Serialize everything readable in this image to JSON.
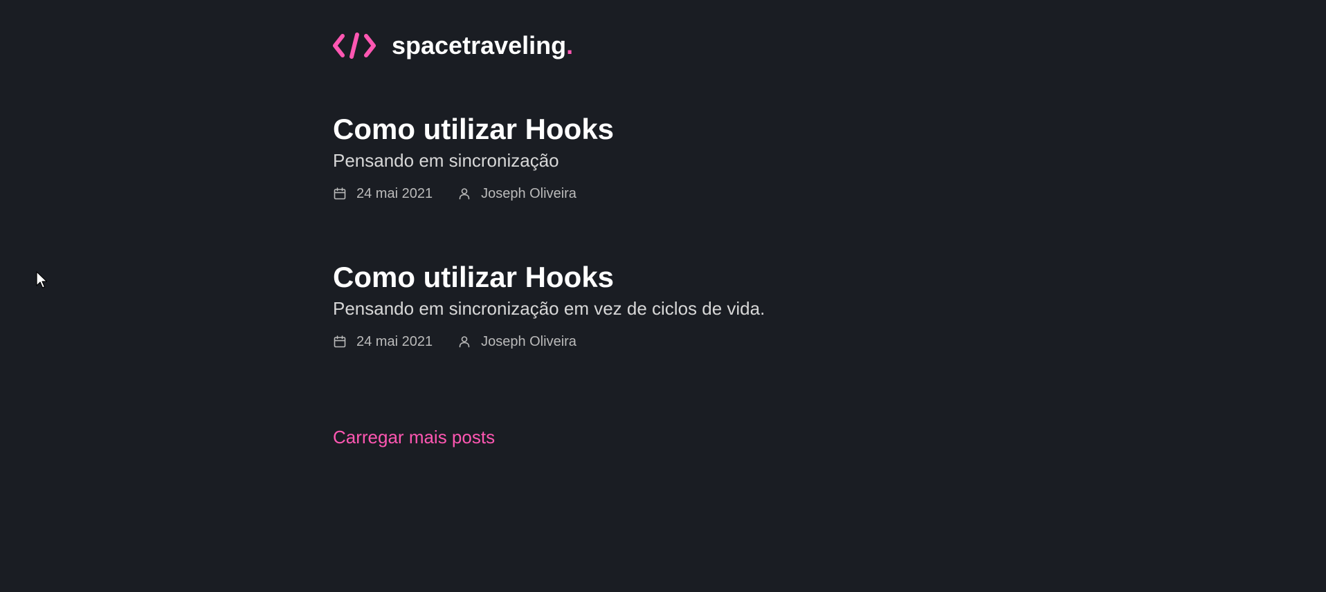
{
  "header": {
    "brand": "spacetraveling",
    "brand_dot": ".",
    "logo_icon": "code-brackets-icon"
  },
  "posts": [
    {
      "title": "Como utilizar Hooks",
      "subtitle": "Pensando em sincronização",
      "date": "24 mai 2021",
      "author": "Joseph Oliveira"
    },
    {
      "title": "Como utilizar Hooks",
      "subtitle": "Pensando em sincronização em vez de ciclos de vida.",
      "date": "24 mai 2021",
      "author": "Joseph Oliveira"
    }
  ],
  "load_more": {
    "label": "Carregar mais posts"
  },
  "colors": {
    "background": "#1a1d23",
    "accent": "#ff57b2",
    "heading": "#ffffff",
    "body": "#d7d7d7",
    "info": "#bbbbbb"
  }
}
